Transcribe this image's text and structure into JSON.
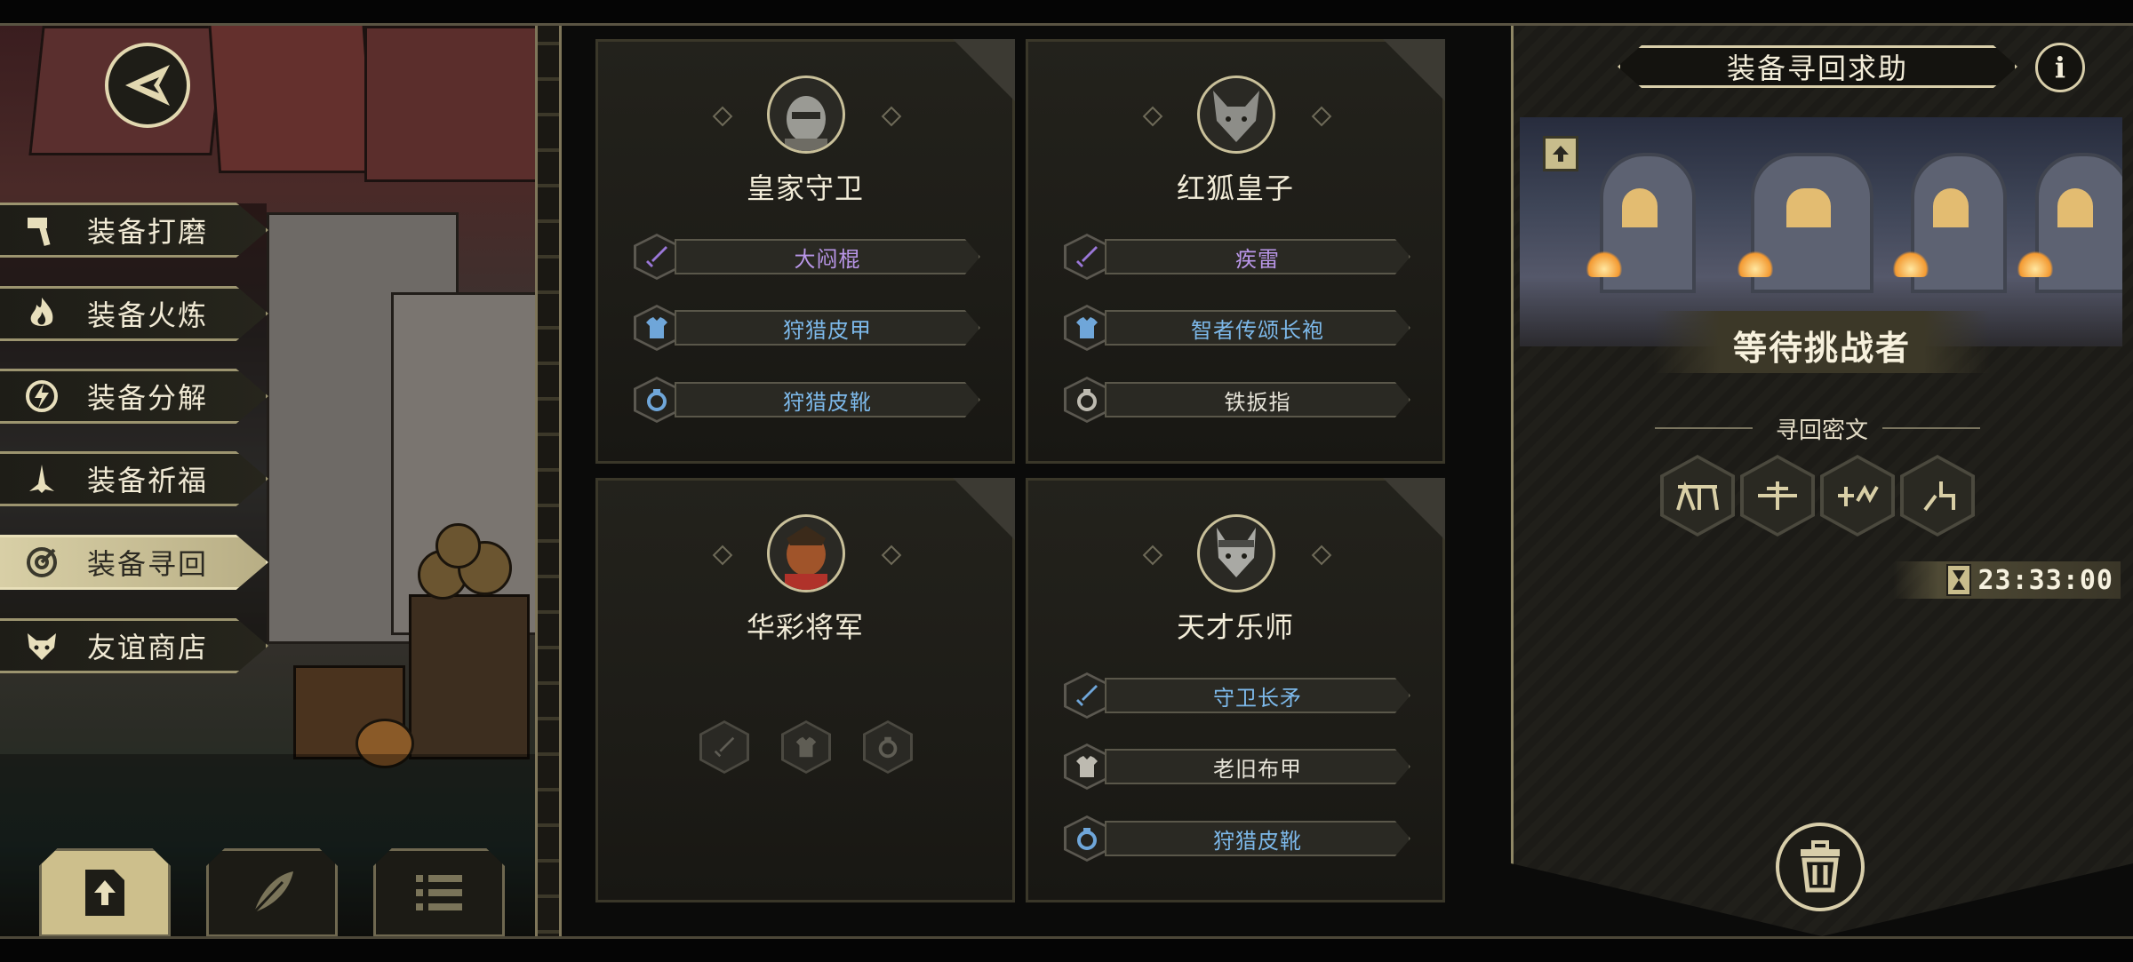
{
  "colors": {
    "gold_border": "#d8ceaa",
    "rarity_purple": "#b996e8",
    "rarity_blue": "#7db9ea",
    "rarity_white": "#e6e3d8",
    "active_tab": "#d8cfa6"
  },
  "back_button": {
    "icon": "back-arrow-icon"
  },
  "side_menu": [
    {
      "label": "装备打磨",
      "icon": "hammer-icon",
      "active": false
    },
    {
      "label": "装备火炼",
      "icon": "flame-icon",
      "active": false
    },
    {
      "label": "装备分解",
      "icon": "lightning-icon",
      "active": false
    },
    {
      "label": "装备祈福",
      "icon": "pray-icon",
      "active": false
    },
    {
      "label": "装备寻回",
      "icon": "target-icon",
      "active": true
    },
    {
      "label": "友谊商店",
      "icon": "fox-icon",
      "active": false
    }
  ],
  "bottom_buttons": [
    {
      "icon": "upload-icon",
      "active": true
    },
    {
      "icon": "feather-icon",
      "active": false
    },
    {
      "icon": "list-icon",
      "active": false
    }
  ],
  "cards": [
    {
      "name": "皇家守卫",
      "avatar": "knight-portrait",
      "equipment": [
        {
          "slot": "weapon-icon",
          "name": "大闷棍",
          "rarity": "purple"
        },
        {
          "slot": "armor-icon",
          "name": "狩猎皮甲",
          "rarity": "blue"
        },
        {
          "slot": "ring-icon",
          "name": "狩猎皮靴",
          "rarity": "blue"
        }
      ]
    },
    {
      "name": "红狐皇子",
      "avatar": "fox-portrait",
      "equipment": [
        {
          "slot": "weapon-icon",
          "name": "疾雷",
          "rarity": "purple"
        },
        {
          "slot": "armor-icon",
          "name": "智者传颂长袍",
          "rarity": "blue"
        },
        {
          "slot": "ring-icon",
          "name": "铁扳指",
          "rarity": "white"
        }
      ]
    },
    {
      "name": "华彩将军",
      "avatar": "general-portrait",
      "equipment": [],
      "empty_slots": [
        "weapon-icon",
        "armor-icon",
        "ring-icon"
      ]
    },
    {
      "name": "天才乐师",
      "avatar": "wolf-portrait",
      "equipment": [
        {
          "slot": "weapon-icon",
          "name": "守卫长矛",
          "rarity": "blue"
        },
        {
          "slot": "armor-icon",
          "name": "老旧布甲",
          "rarity": "white"
        },
        {
          "slot": "ring-icon",
          "name": "狩猎皮靴",
          "rarity": "blue"
        }
      ]
    }
  ],
  "right_panel": {
    "title": "装备寻回求助",
    "info_icon": "i",
    "status": "等待挑战者",
    "cipher_label": "寻回密文",
    "runes": [
      "rune-1-icon",
      "rune-2-icon",
      "rune-3-icon",
      "rune-4-icon"
    ],
    "timer": "23:33:00"
  }
}
